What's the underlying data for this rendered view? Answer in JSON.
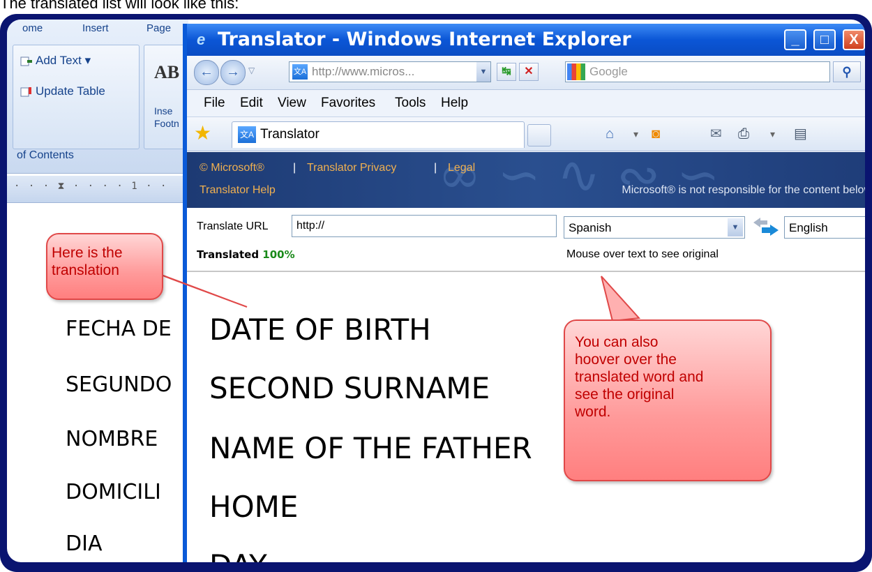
{
  "caption": "The translated list will look like this:",
  "word": {
    "tabs": [
      "ome",
      "Insert",
      "Page"
    ],
    "buttons": {
      "add_text": "Add Text ▾",
      "update_table": "Update Table"
    },
    "group_label": "of Contents",
    "footnote": {
      "big": "AB",
      "line1": "Inse",
      "line2": "Footn"
    },
    "ruler": "· · · ⧗ · · · · 1 · ·",
    "doc_items": [
      "FECHA DE",
      "SEGUNDO",
      "NOMBRE",
      "DOMICILI",
      "DIA"
    ]
  },
  "ie": {
    "title": "Translator - Windows Internet Explorer",
    "window_buttons": {
      "minimize": "_",
      "maximize": "□",
      "close": "X"
    },
    "address": "http://www.micros...",
    "search_placeholder": "Google",
    "menu": [
      "File",
      "Edit",
      "View",
      "Favorites",
      "Tools",
      "Help"
    ],
    "tab_title": "Translator",
    "banner": {
      "microsoft": "© Microsoft®",
      "privacy": "Translator Privacy",
      "legal": "Legal",
      "help": "Translator Help",
      "sep": "|",
      "note": "Microsoft® is not responsible for the content below"
    },
    "controls": {
      "url_label": "Translate URL",
      "url_value": "http://",
      "from_lang": "Spanish",
      "to_lang": "English",
      "translated_label": "Translated",
      "translated_pct": "100%",
      "hover_hint": "Mouse over text to see original"
    },
    "content": [
      "DATE OF BIRTH",
      "SECOND SURNAME",
      "NAME OF THE FATHER",
      "HOME",
      "DAY"
    ]
  },
  "callouts": {
    "translation": [
      "Here is the",
      "translation"
    ],
    "hover": [
      "You can also",
      "hoover over the",
      "translated word and",
      "see the original",
      "word."
    ]
  },
  "colors": {
    "frame": "#0a1470",
    "ie_title": "#0b56d6",
    "callout_text": "#c00000",
    "banner_link": "#f0b050",
    "percent": "#1a8a1a"
  }
}
